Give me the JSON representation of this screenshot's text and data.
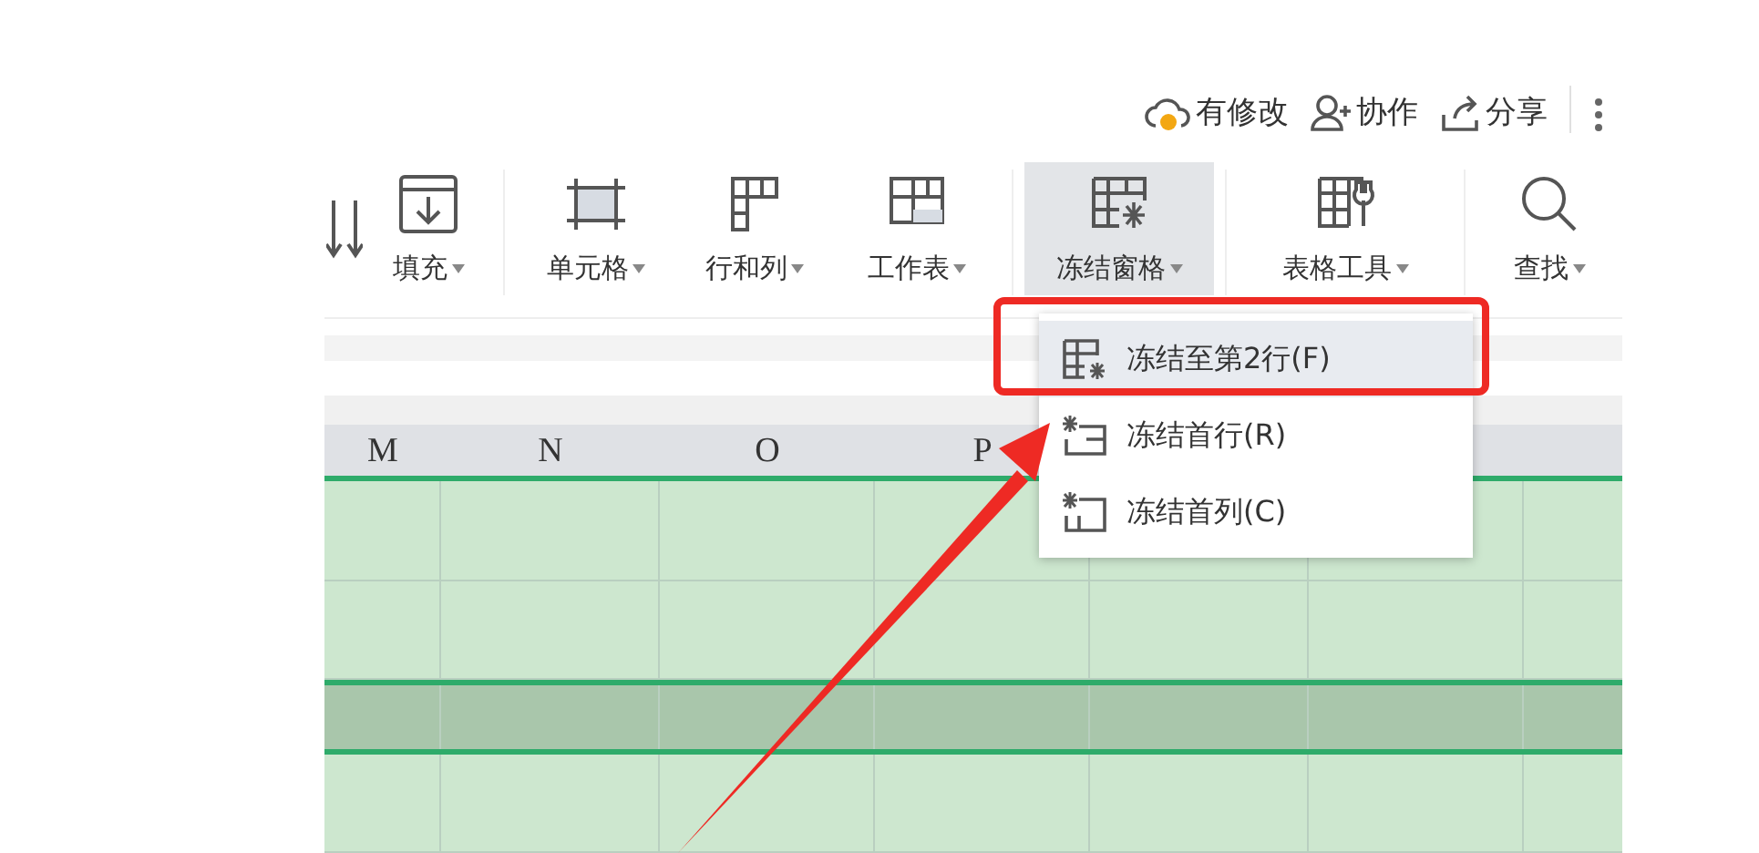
{
  "header_actions": [
    {
      "kind": "changes",
      "label": "有修改"
    },
    {
      "kind": "collab",
      "label": "协作"
    },
    {
      "kind": "share",
      "label": "分享"
    }
  ],
  "ribbon": [
    {
      "kind": "sort",
      "selected": false
    },
    {
      "kind": "fill",
      "label": "填充",
      "selected": false
    },
    {
      "kind": "cell",
      "label": "单元格",
      "selected": false
    },
    {
      "kind": "rowcol",
      "label": "行和列",
      "selected": false
    },
    {
      "kind": "sheet",
      "label": "工作表",
      "selected": false
    },
    {
      "kind": "freeze",
      "label": "冻结窗格",
      "selected": true
    },
    {
      "kind": "tools",
      "label": "表格工具",
      "selected": false
    },
    {
      "kind": "find",
      "label": "查找",
      "selected": false
    }
  ],
  "freeze_menu": [
    {
      "kind": "to_row",
      "label": "冻结至第2行(F)",
      "selected": true
    },
    {
      "kind": "first_row",
      "label": "冻结首行(R)",
      "selected": false
    },
    {
      "kind": "first_col",
      "label": "冻结首列(C)",
      "selected": false
    }
  ],
  "sheet": {
    "columns": [
      "M",
      "N",
      "O",
      "P"
    ],
    "rows": [
      {
        "highlighted": false
      },
      {
        "highlighted": false
      },
      {
        "highlighted": true
      },
      {
        "highlighted": false
      }
    ]
  },
  "annotation": {
    "highlight_box": true,
    "arrow": true
  }
}
